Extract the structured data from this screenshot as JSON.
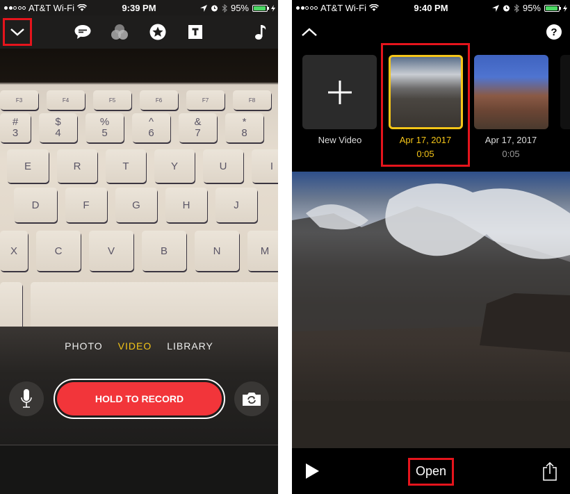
{
  "left_screen": {
    "status_bar": {
      "carrier": "AT&T Wi-Fi",
      "time": "9:39 PM",
      "battery": "95%",
      "battery_level": 0.95,
      "signal_bars_filled": 2,
      "signal_bars_total": 5
    },
    "toolbar": {
      "icons": [
        "chevron-down-icon",
        "speech-bubble-icon",
        "filters-icon",
        "star-icon",
        "text-icon",
        "music-note-icon"
      ],
      "highlighted": "chevron-down-icon"
    },
    "camera_view": {
      "description": "Keyboard as seen through camera",
      "key_rows": [
        [
          "F3",
          "F4",
          "F5",
          "F6",
          "F7",
          "F8"
        ],
        [
          "#\n3",
          "$\n4",
          "%\n5",
          "^\n6",
          "&\n7",
          "*\n8"
        ],
        [
          "E",
          "R",
          "T",
          "Y",
          "U",
          "I"
        ],
        [
          "D",
          "F",
          "G",
          "H",
          "J"
        ],
        [
          "X",
          "C",
          "V",
          "B",
          "N",
          "M"
        ]
      ]
    },
    "modes": [
      {
        "label": "PHOTO",
        "active": false
      },
      {
        "label": "VIDEO",
        "active": true
      },
      {
        "label": "LIBRARY",
        "active": false
      }
    ],
    "record_button": "HOLD TO RECORD",
    "accent_color": "#f5c518",
    "record_color": "#f2353a"
  },
  "right_screen": {
    "status_bar": {
      "carrier": "AT&T Wi-Fi",
      "time": "9:40 PM",
      "battery": "95%",
      "battery_level": 0.95,
      "signal_bars_filled": 2,
      "signal_bars_total": 5
    },
    "topbar": {
      "left_icon": "chevron-up-icon",
      "right_icon": "help-icon"
    },
    "projects": [
      {
        "label": "New Video",
        "sub": "",
        "type": "new"
      },
      {
        "label": "Apr 17, 2017",
        "sub": "0:05",
        "type": "video",
        "selected": true
      },
      {
        "label": "Apr 17, 2017",
        "sub": "0:05",
        "type": "video",
        "selected": false
      }
    ],
    "bottom_bar": {
      "play_icon": "play-icon",
      "open_label": "Open",
      "share_icon": "share-icon"
    },
    "highlight_color": "#e5141c"
  }
}
